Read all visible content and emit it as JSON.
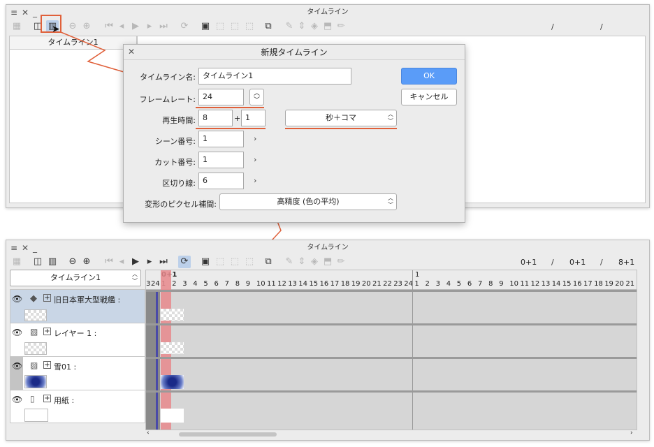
{
  "colors": {
    "accent": "#e0603a",
    "ok_blue": "#5a9cf8",
    "selected_layer": "#c9d6e6",
    "playhead_red": "#e8888c"
  },
  "top_panel": {
    "title": "タイムライン",
    "menu_icon": "hamburger-icon",
    "close_icon": "close-icon",
    "minimize_icon": "minimize-icon",
    "slash1": "/",
    "slash2": "/",
    "layer_column_header": "タイムライン1"
  },
  "dialog": {
    "title": "新規タイムライン",
    "name_label": "タイムライン名:",
    "name_value": "タイムライン1",
    "framerate_label": "フレームレート:",
    "framerate_value": "24",
    "duration_label": "再生時間:",
    "duration_sec": "8",
    "plus": "+",
    "duration_frame": "1",
    "unit_value": "秒＋コマ",
    "scene_label": "シーン番号:",
    "scene_value": "1",
    "cut_label": "カット番号:",
    "cut_value": "1",
    "divider_label": "区切り線:",
    "divider_value": "6",
    "interp_label": "変形のピクセル補間:",
    "interp_value": "高精度 (色の平均)",
    "ok_label": "OK",
    "cancel_label": "キャンセル"
  },
  "bottom_panel": {
    "title": "タイムライン",
    "counter1": "0+1",
    "slash1": "/",
    "counter2": "0+1",
    "slash2": "/",
    "counter3": "8+1",
    "timeline_select": "タイムライン1",
    "ruler_top_left": "0+1",
    "ruler_top_second": "1",
    "pre_frames": [
      "3",
      "24"
    ],
    "frames": [
      "1",
      "2",
      "3",
      "4",
      "5",
      "6",
      "7",
      "8",
      "9",
      "10",
      "11",
      "12",
      "13",
      "14",
      "15",
      "16",
      "17",
      "18",
      "19",
      "20",
      "21",
      "22",
      "23",
      "24",
      "1",
      "2",
      "3",
      "4",
      "5",
      "6",
      "7",
      "8",
      "9",
      "10",
      "11",
      "12",
      "13",
      "14",
      "15",
      "16",
      "17",
      "18",
      "19",
      "20",
      "21",
      "22"
    ],
    "layers": [
      {
        "name": "旧日本軍大型戦艦 :",
        "icon": "3d-icon"
      },
      {
        "name": "レイヤー 1 :",
        "icon": "image-icon"
      },
      {
        "name": "雪01 :",
        "icon": "image-icon"
      },
      {
        "name": "用紙 :",
        "icon": "paper-icon"
      }
    ]
  }
}
